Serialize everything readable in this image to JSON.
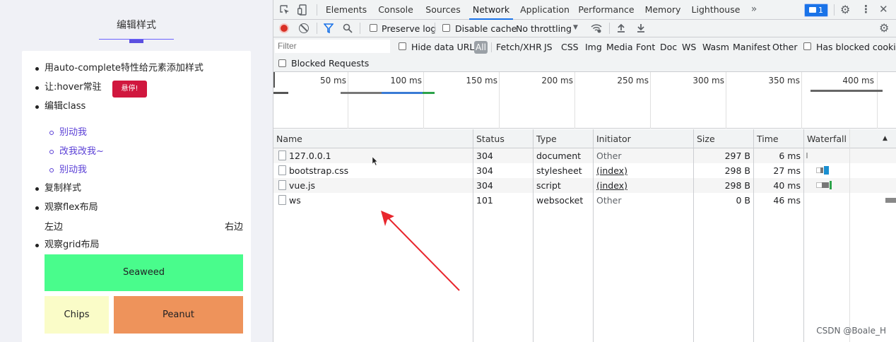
{
  "page": {
    "heading": "编辑样式",
    "list": [
      "用auto-complete特性给元素添加样式",
      "让:hover常驻",
      "编辑class",
      "复制样式",
      "观察flex布局",
      "观察grid布局"
    ],
    "hover_button": "悬停!",
    "class_items": [
      "别动我",
      "改我改我~",
      "别动我"
    ],
    "flex_left": "左边",
    "flex_right": "右边",
    "grid": {
      "a": "Seaweed",
      "b": "Chips",
      "c": "Peanut"
    },
    "colors": {
      "accent": "#5b4fe0",
      "seaweed": "#49fc8c",
      "chips": "#fafcc8",
      "peanut": "#ee935b",
      "hover_btn": "#d0173e"
    }
  },
  "devtools": {
    "tabs": [
      "Elements",
      "Console",
      "Sources",
      "Network",
      "Application",
      "Performance",
      "Memory",
      "Lighthouse"
    ],
    "active_tab": "Network",
    "more_tabs": "»",
    "issues_count": "1",
    "toolbar": {
      "preserve_log": "Preserve log",
      "disable_cache": "Disable cache",
      "throttling": "No throttling"
    },
    "filter": {
      "placeholder": "Filter",
      "hide_data_urls": "Hide data URLs",
      "types": [
        "All",
        "Fetch/XHR",
        "JS",
        "CSS",
        "Img",
        "Media",
        "Font",
        "Doc",
        "WS",
        "Wasm",
        "Manifest",
        "Other"
      ],
      "has_blocked_cookies": "Has blocked cookies",
      "blocked_requests": "Blocked Requests"
    },
    "timeline_ticks": [
      "50 ms",
      "100 ms",
      "150 ms",
      "200 ms",
      "250 ms",
      "300 ms",
      "350 ms",
      "400 ms"
    ],
    "columns": [
      "Name",
      "Status",
      "Type",
      "Initiator",
      "Size",
      "Time",
      "Waterfall"
    ],
    "requests": [
      {
        "name": "127.0.0.1",
        "status": "304",
        "type": "document",
        "initiator": "Other",
        "size": "297 B",
        "time": "6 ms"
      },
      {
        "name": "bootstrap.css",
        "status": "304",
        "type": "stylesheet",
        "initiator": "(index)",
        "size": "298 B",
        "time": "27 ms"
      },
      {
        "name": "vue.js",
        "status": "304",
        "type": "script",
        "initiator": "(index)",
        "size": "298 B",
        "time": "40 ms"
      },
      {
        "name": "ws",
        "status": "101",
        "type": "websocket",
        "initiator": "Other",
        "size": "0 B",
        "time": "46 ms"
      }
    ]
  },
  "watermark": "CSDN @Boale_H"
}
